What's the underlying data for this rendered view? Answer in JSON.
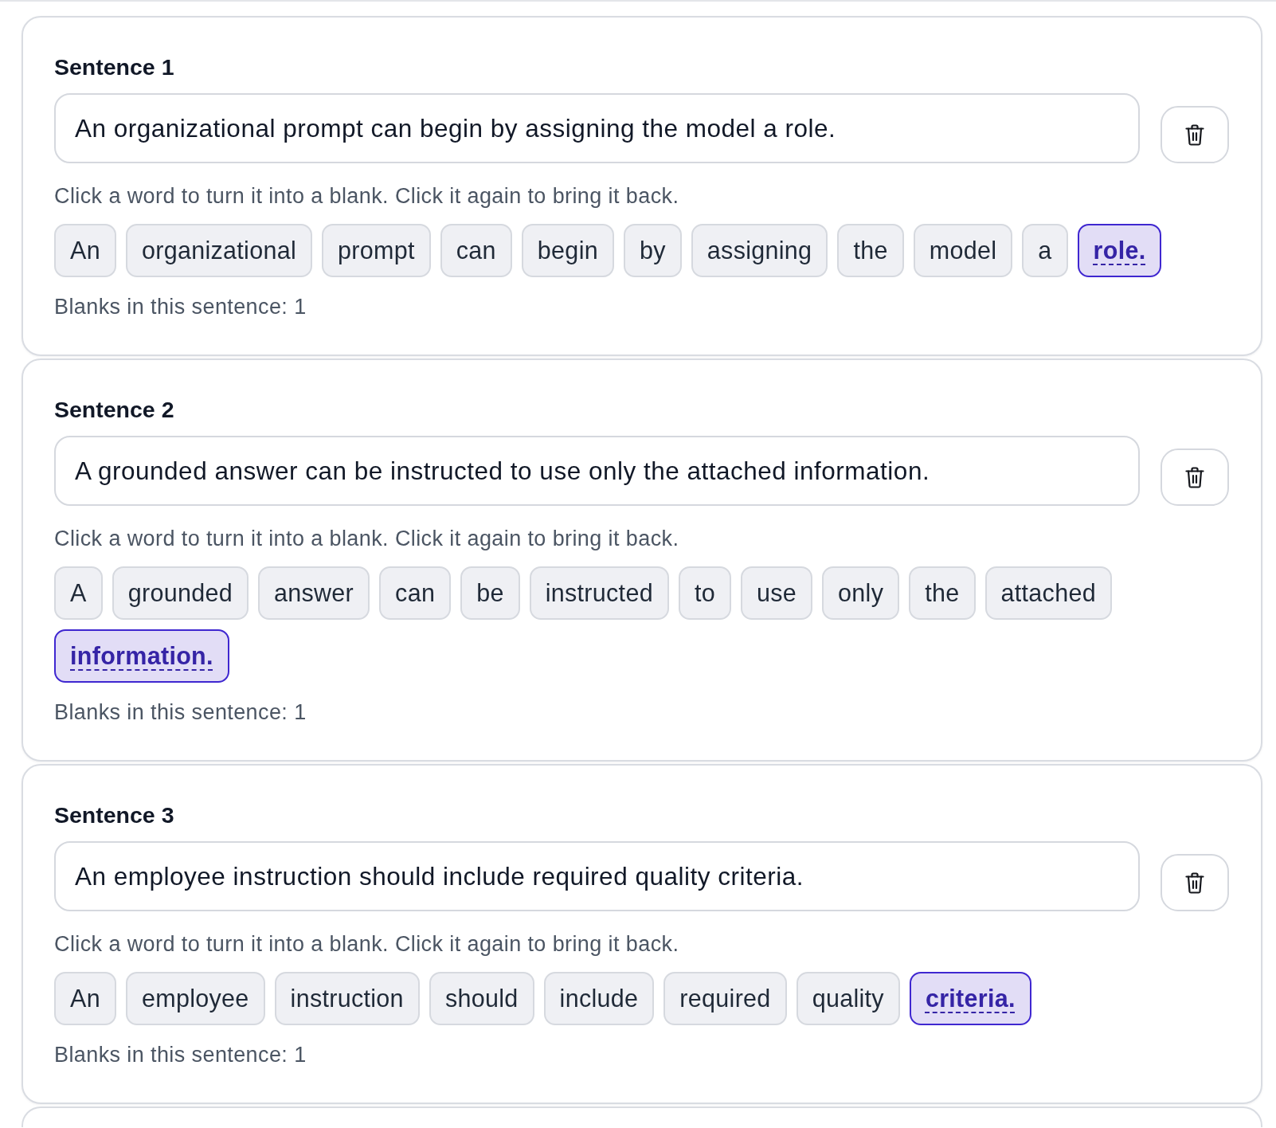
{
  "sentences": [
    {
      "heading": "Sentence 1",
      "text": "An organizational prompt can begin by assigning the model a role.",
      "hint": "Click a word to turn it into a blank. Click it again to bring it back.",
      "words": [
        {
          "label": "An",
          "selected": false
        },
        {
          "label": "organizational",
          "selected": false
        },
        {
          "label": "prompt",
          "selected": false
        },
        {
          "label": "can",
          "selected": false
        },
        {
          "label": "begin",
          "selected": false
        },
        {
          "label": "by",
          "selected": false
        },
        {
          "label": "assigning",
          "selected": false
        },
        {
          "label": "the",
          "selected": false
        },
        {
          "label": "model",
          "selected": false
        },
        {
          "label": "a",
          "selected": false
        },
        {
          "label": "role.",
          "selected": true
        }
      ],
      "blank_count": "Blanks in this sentence: 1"
    },
    {
      "heading": "Sentence 2",
      "text": "A grounded answer can be instructed to use only the attached information.",
      "hint": "Click a word to turn it into a blank. Click it again to bring it back.",
      "words": [
        {
          "label": "A",
          "selected": false
        },
        {
          "label": "grounded",
          "selected": false
        },
        {
          "label": "answer",
          "selected": false
        },
        {
          "label": "can",
          "selected": false
        },
        {
          "label": "be",
          "selected": false
        },
        {
          "label": "instructed",
          "selected": false
        },
        {
          "label": "to",
          "selected": false
        },
        {
          "label": "use",
          "selected": false
        },
        {
          "label": "only",
          "selected": false
        },
        {
          "label": "the",
          "selected": false
        },
        {
          "label": "attached",
          "selected": false
        },
        {
          "label": "information.",
          "selected": true
        }
      ],
      "blank_count": "Blanks in this sentence: 1"
    },
    {
      "heading": "Sentence 3",
      "text": "An employee instruction should include required quality criteria.",
      "hint": "Click a word to turn it into a blank. Click it again to bring it back.",
      "words": [
        {
          "label": "An",
          "selected": false
        },
        {
          "label": "employee",
          "selected": false
        },
        {
          "label": "instruction",
          "selected": false
        },
        {
          "label": "should",
          "selected": false
        },
        {
          "label": "include",
          "selected": false
        },
        {
          "label": "required",
          "selected": false
        },
        {
          "label": "quality",
          "selected": false
        },
        {
          "label": "criteria.",
          "selected": true
        }
      ],
      "blank_count": "Blanks in this sentence: 1"
    }
  ]
}
